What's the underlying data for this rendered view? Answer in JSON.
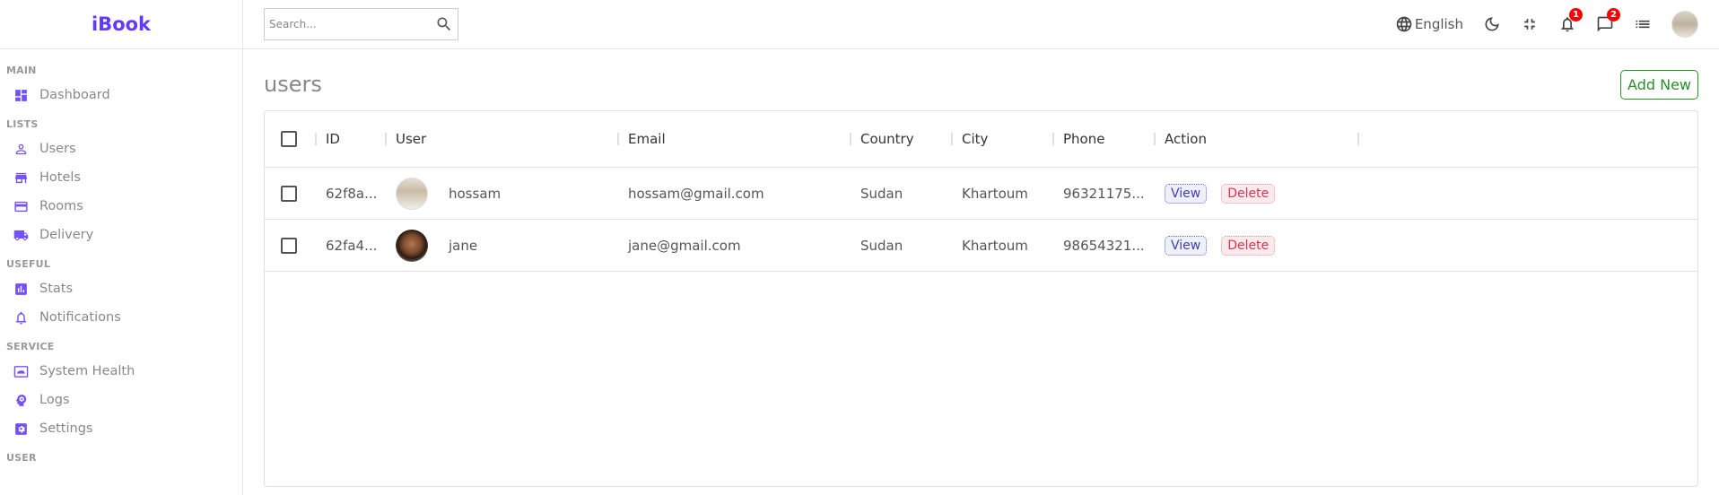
{
  "app": {
    "logo": "iBook"
  },
  "sidebar": {
    "sections": [
      {
        "title": "MAIN",
        "items": [
          {
            "label": "Dashboard",
            "icon": "dashboard-icon"
          }
        ]
      },
      {
        "title": "LISTS",
        "items": [
          {
            "label": "Users",
            "icon": "person-icon"
          },
          {
            "label": "Hotels",
            "icon": "store-icon"
          },
          {
            "label": "Rooms",
            "icon": "credit-card-icon"
          },
          {
            "label": "Delivery",
            "icon": "truck-icon"
          }
        ]
      },
      {
        "title": "USEFUL",
        "items": [
          {
            "label": "Stats",
            "icon": "bar-chart-icon"
          },
          {
            "label": "Notifications",
            "icon": "bell-icon"
          }
        ]
      },
      {
        "title": "SERVICE",
        "items": [
          {
            "label": "System Health",
            "icon": "health-icon"
          },
          {
            "label": "Logs",
            "icon": "psychology-icon"
          },
          {
            "label": "Settings",
            "icon": "settings-icon"
          }
        ]
      },
      {
        "title": "USER",
        "items": []
      }
    ]
  },
  "topbar": {
    "search_placeholder": "Search...",
    "language": "English",
    "notifications_count": "1",
    "messages_count": "2"
  },
  "page": {
    "title": "users",
    "add_new_label": "Add New"
  },
  "table": {
    "columns": [
      "ID",
      "User",
      "Email",
      "Country",
      "City",
      "Phone",
      "Action"
    ],
    "rows": [
      {
        "id": "62f8a...",
        "user": "hossam",
        "email": "hossam@gmail.com",
        "country": "Sudan",
        "city": "Khartoum",
        "phone": "96321175...",
        "view": "View",
        "delete": "Delete"
      },
      {
        "id": "62fa4...",
        "user": "jane",
        "email": "jane@gmail.com",
        "country": "Sudan",
        "city": "Khartoum",
        "phone": "98654321...",
        "view": "View",
        "delete": "Delete"
      }
    ]
  },
  "colors": {
    "accent": "#6439ff",
    "icon": "#7451f8",
    "add_new": "#2a8f2a",
    "view": "#3f3fb3",
    "delete": "#dc3450",
    "badge": "#ff0000"
  }
}
